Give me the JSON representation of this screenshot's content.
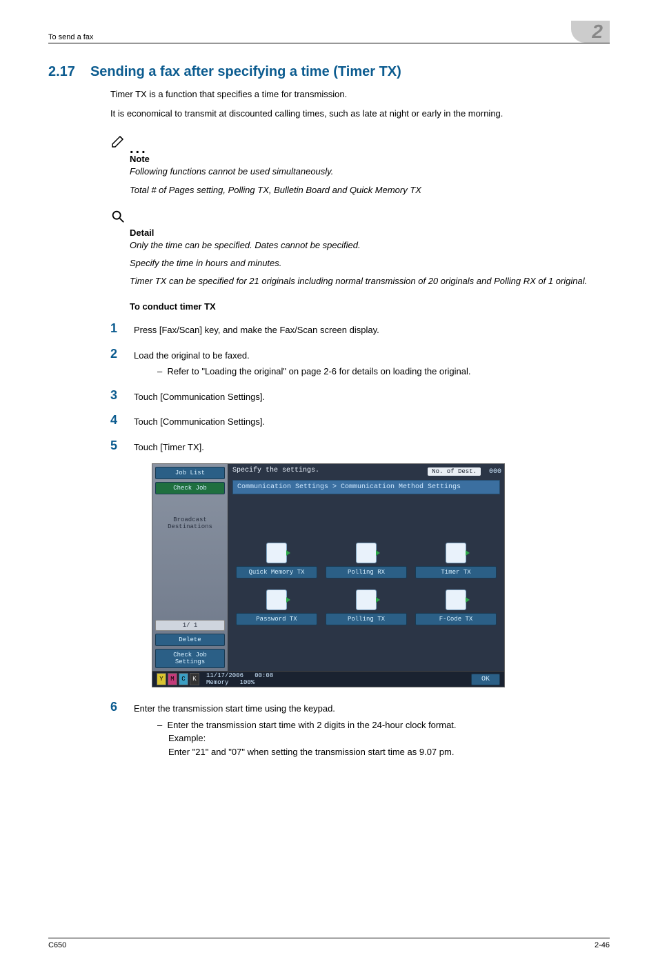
{
  "header": {
    "breadcrumb": "To send a fax",
    "chapter_num": "2"
  },
  "section": {
    "num": "2.17",
    "title": "Sending a fax after specifying a time (Timer TX)",
    "intro1": "Timer TX is a function that specifies a time for transmission.",
    "intro2": "It is economical to transmit at discounted calling times, such as late at night or early in the morning."
  },
  "note": {
    "label": "Note",
    "line1": "Following functions cannot be used simultaneously.",
    "line2": "Total # of Pages setting, Polling TX, Bulletin Board and Quick Memory TX"
  },
  "detail": {
    "label": "Detail",
    "line1": "Only the time can be specified. Dates cannot be specified.",
    "line2": "Specify the time in hours and minutes.",
    "line3": "Timer TX can be specified for 21 originals including normal transmission of 20 originals and Polling RX of 1 original."
  },
  "procedure": {
    "heading": "To conduct timer TX",
    "steps": {
      "s1": "Press [Fax/Scan] key, and make the Fax/Scan screen display.",
      "s2": "Load the original to be faxed.",
      "s2_sub": "Refer to \"Loading the original\" on page 2-6 for details on loading the original.",
      "s3": "Touch [Communication Settings].",
      "s4": "Touch [Communication Settings].",
      "s5": "Touch [Timer TX].",
      "s6": "Enter the transmission start time using the keypad.",
      "s6_sub1": "Enter the transmission start time with 2 digits in the 24-hour clock format.",
      "s6_sub2": "Example:",
      "s6_sub3": "Enter \"21\" and \"07\" when setting the transmission start time as 9.07 pm."
    }
  },
  "device": {
    "side": {
      "job_list": "Job List",
      "check_job": "Check Job",
      "broadcast": "Broadcast Destinations",
      "page_indicator": "1/  1",
      "delete": "Delete",
      "check_job_settings": "Check Job Settings"
    },
    "title": "Specify the settings.",
    "dest_label": "No. of Dest.",
    "dest_count": "000",
    "crumb": "Communication Settings > Communication Method Settings",
    "options": {
      "quick_memory_tx": "Quick Memory TX",
      "polling_rx": "Polling RX",
      "timer_tx": "Timer TX",
      "password_tx": "Password TX",
      "polling_tx": "Polling TX",
      "fcode_tx": "F-Code TX"
    },
    "status": {
      "date": "11/17/2006",
      "time": "00:08",
      "mem_label": "Memory",
      "mem_value": "100%",
      "ok": "OK"
    },
    "toner": {
      "y": "Y",
      "m": "M",
      "c": "C",
      "k": "K"
    }
  },
  "footer": {
    "model": "C650",
    "page": "2-46"
  }
}
